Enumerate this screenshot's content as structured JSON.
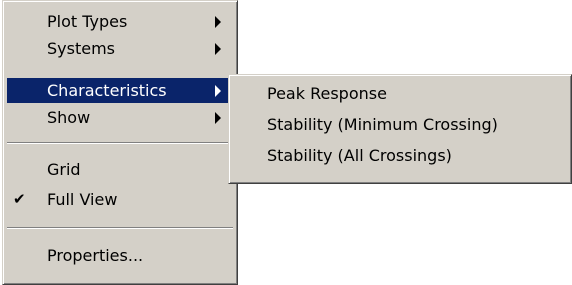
{
  "main_menu": {
    "items": [
      {
        "label": "Plot Types",
        "has_submenu": true
      },
      {
        "label": "Systems",
        "has_submenu": true
      },
      {
        "label": "Characteristics",
        "has_submenu": true,
        "selected": true
      },
      {
        "label": "Show",
        "has_submenu": true
      },
      {
        "label": "Grid",
        "checked": false
      },
      {
        "label": "Full View",
        "checked": true
      },
      {
        "label": "Properties..."
      }
    ],
    "check_mark": "✔"
  },
  "sub_menu": {
    "items": [
      {
        "label": "Peak Response"
      },
      {
        "label": "Stability (Minimum Crossing)"
      },
      {
        "label": "Stability (All Crossings)"
      }
    ]
  },
  "colors": {
    "menu_background": "#d4d0c8",
    "selection": "#0a246a",
    "selection_text": "#ffffff"
  }
}
